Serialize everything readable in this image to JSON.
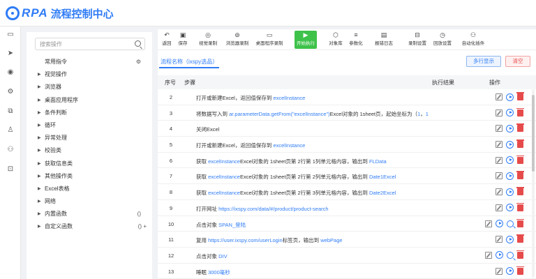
{
  "app": {
    "logo_text": "RPA",
    "title": "流程控制中心"
  },
  "rail": {
    "icons": [
      "monitor-icon",
      "send-icon",
      "robot-icon",
      "settings-icon",
      "copy-icon",
      "user-icon",
      "team-icon",
      "lock-icon"
    ]
  },
  "sidebar": {
    "search_placeholder": "搜索操作",
    "common_label": "常用指令",
    "items": [
      {
        "label": "视觉操作",
        "icon": ""
      },
      {
        "label": "浏览器",
        "icon": ""
      },
      {
        "label": "桌面应用程序",
        "icon": ""
      },
      {
        "label": "条件判断",
        "icon": ""
      },
      {
        "label": "循环",
        "icon": ""
      },
      {
        "label": "异常处理",
        "icon": ""
      },
      {
        "label": "校验类",
        "icon": ""
      },
      {
        "label": "获取信息类",
        "icon": ""
      },
      {
        "label": "其他操作类",
        "icon": ""
      },
      {
        "label": "Excel表格",
        "icon": ""
      },
      {
        "label": "网络",
        "icon": ""
      },
      {
        "label": "内置函数",
        "icon": "()"
      },
      {
        "label": "自定义函数",
        "icon": "() +"
      }
    ]
  },
  "toolbar": {
    "items": [
      {
        "label": "返回",
        "icon": "↶"
      },
      {
        "label": "保存",
        "icon": "▣"
      },
      {
        "label": "视觉录制",
        "icon": "◎"
      },
      {
        "label": "浏览器录制",
        "icon": "⊚"
      },
      {
        "label": "桌面程序录制",
        "icon": "▭"
      },
      {
        "label": "开始执行",
        "icon": "▶"
      },
      {
        "label": "对象库",
        "icon": "⬡"
      },
      {
        "label": "参数化",
        "icon": "≡"
      },
      {
        "label": "报错日志",
        "icon": "▤"
      },
      {
        "label": "录制设置",
        "icon": "⊟"
      },
      {
        "label": "回放设置",
        "icon": "◷"
      },
      {
        "label": "自动化插件",
        "icon": "⚇"
      }
    ]
  },
  "tabs": {
    "active": "流程名称（ixspy选品）"
  },
  "buttons": {
    "multi": "多行显示",
    "clear": "清空"
  },
  "table": {
    "headers": {
      "no": "序号",
      "step": "步骤",
      "result": "执行结果",
      "action": "操作"
    },
    "rows": [
      {
        "no": "2",
        "parts": [
          [
            "打开或新建Excel，返回值保存到 ",
            0
          ],
          [
            "excelInstance",
            1
          ]
        ],
        "extra": false
      },
      {
        "no": "3",
        "parts": [
          [
            "将数据写入到 ",
            0
          ],
          [
            "ar.parameterData.getFrom(\"excelInstance\")",
            1
          ],
          [
            "Excel对象的 1sheet页，起始坐标为（",
            0
          ],
          [
            "1",
            1
          ],
          [
            "，",
            0
          ],
          [
            "1",
            1
          ]
        ],
        "extra": false
      },
      {
        "no": "4",
        "parts": [
          [
            "关闭Excel",
            0
          ]
        ],
        "extra": false
      },
      {
        "no": "5",
        "parts": [
          [
            "打开或新建Excel，返回值保存到 ",
            0
          ],
          [
            "excelInstance",
            1
          ]
        ],
        "extra": false
      },
      {
        "no": "6",
        "parts": [
          [
            "获取 ",
            0
          ],
          [
            "excelInstance",
            1
          ],
          [
            "Excel对象的 1sheet页第 2行第 1列单元格内容，输出到 ",
            0
          ],
          [
            "FLData",
            1
          ]
        ],
        "extra": false
      },
      {
        "no": "7",
        "parts": [
          [
            "获取 ",
            0
          ],
          [
            "excelInstance",
            1
          ],
          [
            "Excel对象的 1sheet页第 2行第 2列单元格内容，输出到 ",
            0
          ],
          [
            "Date1Excel",
            1
          ]
        ],
        "extra": false
      },
      {
        "no": "8",
        "parts": [
          [
            "获取 ",
            0
          ],
          [
            "excelInstance",
            1
          ],
          [
            "Excel对象的 1sheet页第 2行第 3列单元格内容，输出到 ",
            0
          ],
          [
            "Date2Excel",
            1
          ]
        ],
        "extra": false
      },
      {
        "no": "9",
        "parts": [
          [
            "打开网址 ",
            0
          ],
          [
            "https://ixspy.com/data/#/product/product-search",
            1
          ]
        ],
        "extra": false
      },
      {
        "no": "10",
        "parts": [
          [
            "点击对象 ",
            0
          ],
          [
            "SPAN_登陆",
            1
          ]
        ],
        "extra": true
      },
      {
        "no": "11",
        "parts": [
          [
            "复用 ",
            0
          ],
          [
            "https://user.ixspy.com/userLogin",
            1
          ],
          [
            "标签页，输出到 ",
            0
          ],
          [
            "webPage",
            1
          ]
        ],
        "extra": false
      },
      {
        "no": "12",
        "parts": [
          [
            "点击对象 ",
            0
          ],
          [
            "DIV",
            1
          ]
        ],
        "extra": true
      },
      {
        "no": "13",
        "parts": [
          [
            "睡眠 ",
            0
          ],
          [
            "3000毫秒",
            1
          ]
        ],
        "extra": false
      }
    ]
  }
}
